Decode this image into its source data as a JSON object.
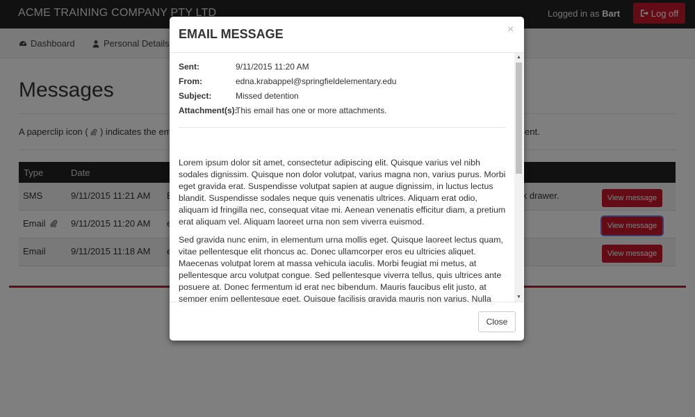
{
  "header": {
    "brand": "ACME TRAINING COMPANY PTY LTD",
    "logged_in_prefix": "Logged in as",
    "user": "Bart",
    "logoff_label": "Log off"
  },
  "nav": {
    "items": [
      {
        "label": "Dashboard",
        "icon": "dashboard-icon"
      },
      {
        "label": "Personal Details",
        "icon": "user-icon"
      }
    ]
  },
  "page": {
    "title": "Messages",
    "intro_start": "A paperclip icon (",
    "intro_end": ") indicates the email",
    "intro_tail": "ent.",
    "table": {
      "headers": [
        "Type",
        "Date"
      ],
      "rows": [
        {
          "type": "SMS",
          "date": "9/11/2015 11:21 AM",
          "frag": "E",
          "tail": "esk drawer.",
          "button": "View message"
        },
        {
          "type": "Email",
          "date": "9/11/2015 11:20 AM",
          "frag": "e",
          "button": "View message",
          "attachment": true
        },
        {
          "type": "Email",
          "date": "9/11/2015 11:18 AM",
          "frag": "e",
          "button": "View message"
        }
      ]
    }
  },
  "modal": {
    "title": "EMAIL MESSAGE",
    "close_x": "×",
    "meta": [
      {
        "label": "Sent:",
        "value": "9/11/2015 11:20 AM"
      },
      {
        "label": "From:",
        "value": "edna.krabappel@springfieldelementary.edu"
      },
      {
        "label": "Subject:",
        "value": "Missed detention"
      },
      {
        "label": "Attachment(s):",
        "value": "This email has one or more attachments."
      }
    ],
    "paragraphs": [
      "Lorem ipsum dolor sit amet, consectetur adipiscing elit. Quisque varius vel nibh sodales dignissim. Quisque non dolor volutpat, varius magna non, varius purus. Morbi eget gravida erat. Suspendisse volutpat sapien at augue dignissim, in luctus lectus blandit. Suspendisse sodales neque quis venenatis ultrices. Aliquam erat odio, aliquam id fringilla nec, consequat vitae mi. Aenean venenatis efficitur diam, a pretium erat aliquam vel. Aliquam laoreet urna non sem viverra euismod.",
      "Sed gravida nunc enim, in elementum urna mollis eget. Quisque laoreet lectus quam, vitae pellentesque elit rhoncus ac. Donec ullamcorper eros eu ultricies aliquet. Maecenas volutpat lorem at massa vehicula iaculis. Morbi feugiat mi metus, at pellentesque arcu volutpat congue. Sed pellentesque viverra tellus, quis ultrices ante posuere at. Donec fermentum id erat nec bibendum. Mauris faucibus elit justo, at semper enim pellentesque eget. Quisque facilisis gravida mauris non varius. Nulla sodales ante a aliquam sagittis. Sed a odio tristique, aliquam est non, pellentesque"
    ],
    "close_label": "Close"
  },
  "colors": {
    "accent": "#c9182b",
    "topbar": "#222222",
    "focus_ring": "#7a7adb"
  }
}
